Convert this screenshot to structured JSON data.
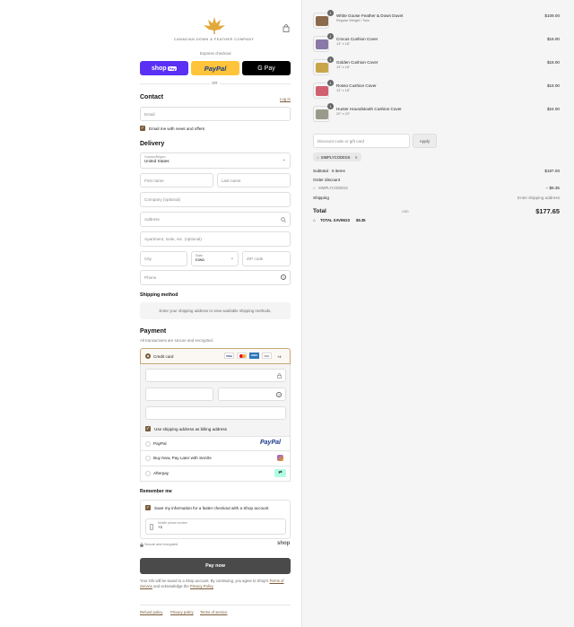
{
  "brand": {
    "name": "CANADIAN DOWN & FEATHER COMPANY",
    "accent": "#7a5c3a"
  },
  "express": {
    "label": "Express checkout",
    "shop_pay": "shop",
    "shop_pay_badge": "Pay",
    "paypal": "PayPal",
    "gpay": "G Pay",
    "or": "OR"
  },
  "contact": {
    "title": "Contact",
    "login": "Log in",
    "email_placeholder": "Email",
    "news_label": "Email me with news and offers"
  },
  "delivery": {
    "title": "Delivery",
    "country_label": "Country/Region",
    "country_value": "United States",
    "first_name": "First name",
    "last_name": "Last name",
    "company": "Company (optional)",
    "address": "Address",
    "apartment": "Apartment, suite, etc. (optional)",
    "city": "City",
    "state_label": "State",
    "state_value": "Iowa",
    "zip": "ZIP code",
    "phone": "Phone"
  },
  "shipping_method": {
    "title": "Shipping method",
    "message": "Enter your shipping address to view available shipping methods."
  },
  "payment": {
    "title": "Payment",
    "subtitle": "All transactions are secure and encrypted.",
    "credit_card": "Credit card",
    "card_more": "+4",
    "card_brands": [
      "VISA",
      "MC",
      "AMEX",
      "DISC"
    ],
    "billing_label": "Use shipping address as billing address",
    "options": [
      "PayPal",
      "Buy Now, Pay Later with Sezzle",
      "Afterpay"
    ],
    "paypal_logo": "PayPal"
  },
  "remember": {
    "title": "Remember me",
    "save_label": "Save my information for a faster checkout with a Shop account",
    "mobile_label": "Mobile phone number",
    "mobile_value": "+1",
    "secure": "Secure and encrypted",
    "shop_logo": "shop"
  },
  "pay_button": "Pay now",
  "legal": {
    "text": "Your info will be saved to a Shop account. By continuing, you agree to Shop's",
    "terms": "Terms of Service",
    "and": "and acknowledge the",
    "privacy": "Privacy Policy"
  },
  "footer": {
    "refund": "Refund policy",
    "privacy": "Privacy policy",
    "terms": "Terms of service"
  },
  "cart": {
    "items": [
      {
        "name": "White Goose Feather & Down Duvet",
        "variant": "Regular Weight / Twin",
        "price": "$109.00",
        "qty": "1",
        "color": "#8a6a4a"
      },
      {
        "name": "Crocus Cushion Cover",
        "variant": "13\" x 18\"",
        "price": "$18.00",
        "qty": "1",
        "color": "#8a78a8"
      },
      {
        "name": "Golden Cushion Cover",
        "variant": "13\" x 18\"",
        "price": "$18.00",
        "qty": "1",
        "color": "#c9a54a"
      },
      {
        "name": "Rosso Cushion Cover",
        "variant": "13\" x 18\"",
        "price": "$18.00",
        "qty": "1",
        "color": "#d06070"
      },
      {
        "name": "Hunter Houndstooth Cushion Cover",
        "variant": "20\" x 20\"",
        "price": "$24.00",
        "qty": "1",
        "color": "#9a9a8a"
      }
    ],
    "discount_placeholder": "Discount code or gift card",
    "apply": "Apply",
    "code": "SIMPLYCODESS",
    "subtotal_label": "Subtotal · 5 items",
    "subtotal": "$187.00",
    "order_discount_label": "Order discount",
    "order_discount_code": "SIMPLYCODESS",
    "order_discount": "− $9.35",
    "shipping_label": "Shipping",
    "shipping_value": "Enter shipping address",
    "total_label": "Total",
    "currency": "USD",
    "total": "$177.65",
    "savings_label": "TOTAL SAVINGS",
    "savings": "$9.35"
  }
}
